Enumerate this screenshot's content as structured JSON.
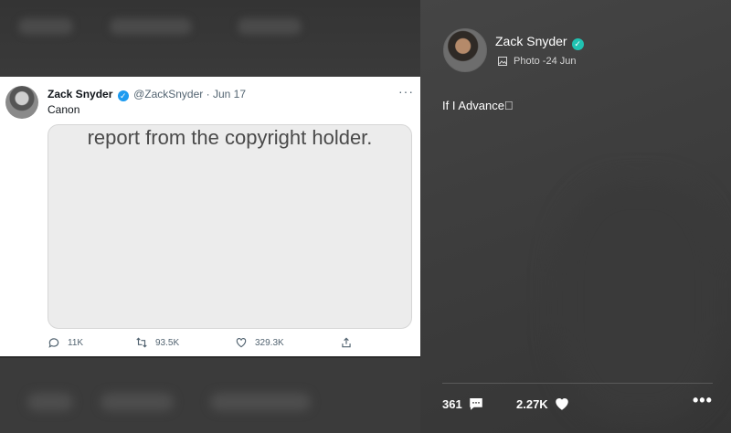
{
  "tweet": {
    "author_name": "Zack Snyder",
    "author_handle": "@ZackSnyder",
    "date": "Jun 17",
    "text": "Canon",
    "media_notice": "report from the copyright holder.",
    "replies": "11K",
    "retweets": "93.5K",
    "likes": "329.3K"
  },
  "post": {
    "author_name": "Zack Snyder",
    "meta": "Photo -24 Jun",
    "caption": "If I Advance\u0000",
    "comments": "361",
    "likes": "2.27K"
  },
  "colors": {
    "twitter_verified": "#1d9bf0",
    "post_verified": "#20c2b2"
  }
}
